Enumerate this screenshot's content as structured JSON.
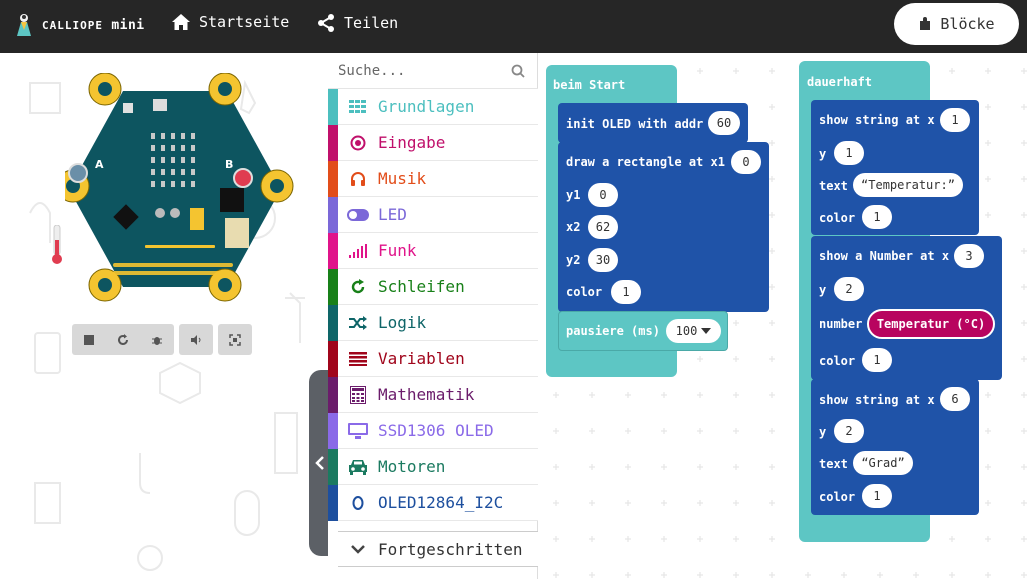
{
  "header": {
    "logo_small": "CALLIOPE",
    "logo_big": "mini",
    "nav_home": "Startseite",
    "nav_share": "Teilen",
    "blocks_button": "Blöcke"
  },
  "search": {
    "placeholder": "Suche..."
  },
  "toolbox": {
    "categories": [
      {
        "label": "Grundlagen",
        "color": "#4cbfbf",
        "icon": "grid-icon"
      },
      {
        "label": "Eingabe",
        "color": "#c0106b",
        "icon": "target-icon"
      },
      {
        "label": "Musik",
        "color": "#e24d1a",
        "icon": "headphones-icon"
      },
      {
        "label": "LED",
        "color": "#7b68d8",
        "icon": "toggle-icon"
      },
      {
        "label": "Funk",
        "color": "#e0148a",
        "icon": "signal-bars-icon"
      },
      {
        "label": "Schleifen",
        "color": "#188019",
        "icon": "refresh-icon"
      },
      {
        "label": "Logik",
        "color": "#0e6568",
        "icon": "shuffle-icon"
      },
      {
        "label": "Variablen",
        "color": "#a0051b",
        "icon": "lines-icon"
      },
      {
        "label": "Mathematik",
        "color": "#6b1c6b",
        "icon": "calculator-icon"
      },
      {
        "label": "SSD1306 OLED",
        "color": "#8a6ae8",
        "icon": "monitor-icon"
      },
      {
        "label": "Motoren",
        "color": "#1b7a60",
        "icon": "car-icon"
      },
      {
        "label": "OLED12864_I2C",
        "color": "#1d4f9e",
        "icon": "o-letter-icon"
      }
    ],
    "advanced": "Fortgeschritten"
  },
  "colors": {
    "teal": "#5dc6c4",
    "block_blue": "#1f53a8",
    "variable_pink": "#b8045f",
    "header_bg": "#262626"
  },
  "workspace": {
    "start": {
      "hat": "beim Start",
      "init_label": "init OLED with addr",
      "init_addr": "60",
      "rect_label": "draw a rectangle at x1",
      "x1": "0",
      "y1_label": "y1",
      "y1": "0",
      "x2_label": "x2",
      "x2": "62",
      "y2_label": "y2",
      "y2": "30",
      "color_label": "color",
      "color": "1",
      "pause_label": "pausiere (ms)",
      "pause_value": "100"
    },
    "forever": {
      "hat": "dauerhaft",
      "b1_label": "show string at x",
      "b1_x": "1",
      "b1_y_label": "y",
      "b1_y": "1",
      "b1_text_label": "text",
      "b1_text": "Temperatur:",
      "b1_color_label": "color",
      "b1_color": "1",
      "b2_label": "show a Number at x",
      "b2_x": "3",
      "b2_y_label": "y",
      "b2_y": "2",
      "b2_number_label": "number",
      "b2_number": "Temperatur (°C)",
      "b2_color_label": "color",
      "b2_color": "1",
      "b3_label": "show string at x",
      "b3_x": "6",
      "b3_y_label": "y",
      "b3_y": "2",
      "b3_text_label": "text",
      "b3_text": "Grad",
      "b3_color_label": "color",
      "b3_color": "1"
    }
  }
}
